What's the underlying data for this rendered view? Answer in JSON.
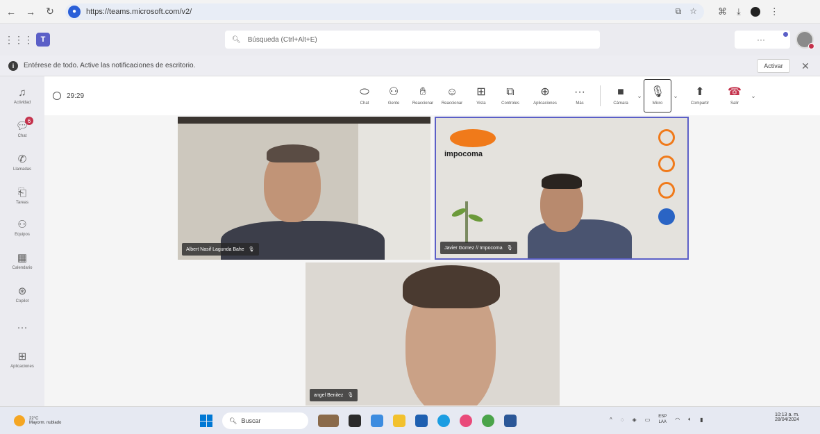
{
  "browser": {
    "url": "https://teams.microsoft.com/v2/"
  },
  "teams": {
    "search_placeholder": "Búsqueda (Ctrl+Alt+E)",
    "more_label": "···"
  },
  "notification": {
    "text": "Entérese de todo. Active las notificaciones de escritorio.",
    "action_label": "Activar"
  },
  "rail": {
    "items": [
      {
        "label": "Actividad",
        "icon": "bell-icon"
      },
      {
        "label": "Chat",
        "icon": "chat-icon",
        "badge": "6"
      },
      {
        "label": "Llamadas",
        "icon": "phone-icon"
      },
      {
        "label": "Tareas",
        "icon": "clipboard-icon"
      },
      {
        "label": "Equipos",
        "icon": "teams-icon"
      },
      {
        "label": "Calendario",
        "icon": "calendar-icon"
      },
      {
        "label": "Copilot",
        "icon": "copilot-icon"
      },
      {
        "label": "···",
        "icon": "more-icon"
      },
      {
        "label": "Aplicaciones",
        "icon": "apps-icon"
      }
    ]
  },
  "meeting": {
    "timer": "29:29",
    "toolbar": {
      "chat": "Chat",
      "people": "Gente",
      "raise": "Reaccionar",
      "react": "Reaccionar",
      "view": "Vista",
      "rooms": "Controles",
      "apps": "Aplicaciones",
      "more": "Más",
      "camera": "Cámara",
      "mic": "Micro",
      "share": "Compartir",
      "leave": "Salir"
    },
    "participants": [
      {
        "name": "Albert Nasif Lagunda Bahe"
      },
      {
        "name": "Javier Gomez // Impocoma"
      },
      {
        "name": "angel Benitez"
      }
    ],
    "logo_text": "impocoma"
  },
  "taskbar": {
    "weather_temp": "22°C",
    "weather_desc": "Mayorm. nublado",
    "search_label": "Buscar",
    "lang_top": "ESP",
    "lang_bottom": "LAA",
    "time": "10:13 a. m.",
    "date": "28/04/2024"
  }
}
